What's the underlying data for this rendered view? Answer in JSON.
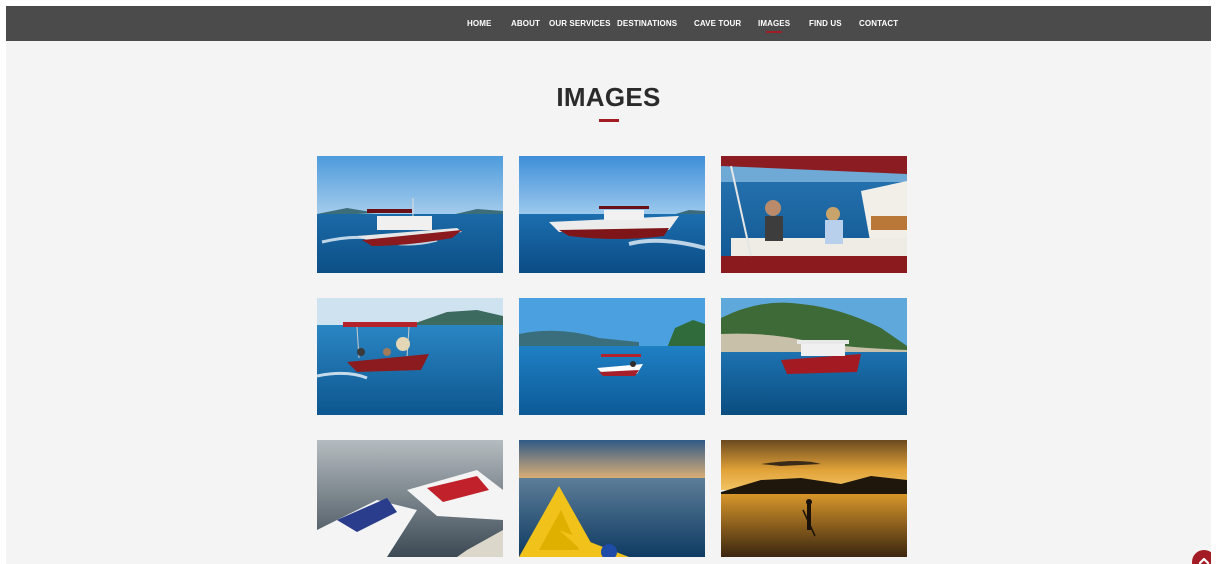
{
  "nav": {
    "items": [
      {
        "label": "HOME",
        "active": false
      },
      {
        "label": "ABOUT",
        "active": false
      },
      {
        "label": "OUR SERVICES",
        "active": false
      },
      {
        "label": "DESTINATIONS",
        "active": false
      },
      {
        "label": "CAVE TOUR",
        "active": false
      },
      {
        "label": "IMAGES",
        "active": true
      },
      {
        "label": "FIND US",
        "active": false
      },
      {
        "label": "CONTACT",
        "active": false
      }
    ]
  },
  "page": {
    "title": "IMAGES"
  },
  "gallery": {
    "images": [
      "boat-photo",
      "boat-photo",
      "boat-passengers-photo",
      "boat-photo",
      "boat-photo",
      "boat-photo",
      "jet-ski-photo",
      "kayak-photo",
      "paddleboard-sunset-photo"
    ]
  },
  "colors": {
    "navbar": "#4b4b4b",
    "accent": "#a31b25",
    "background": "#f4f4f4"
  },
  "icons": {
    "scroll_top": "chevron-up-icon"
  }
}
